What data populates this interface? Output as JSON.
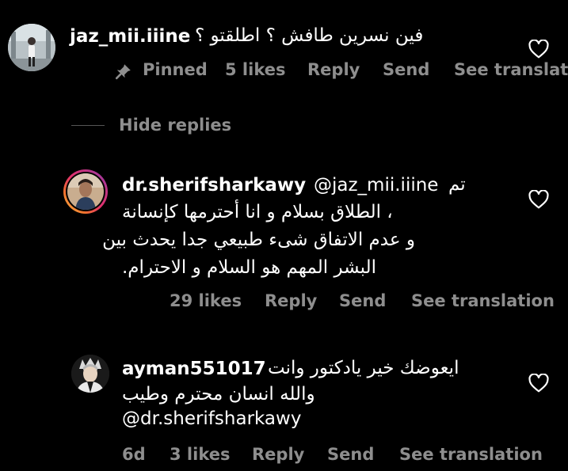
{
  "comment": {
    "username": "jaz_mii.iiine",
    "text": "فين نسرين طافش ؟ اطلقتو ؟",
    "pinned_label": "Pinned",
    "likes": "5 likes",
    "reply": "Reply",
    "send": "Send",
    "see_translation": "See translation"
  },
  "hide_replies": "Hide replies",
  "reply1": {
    "username": "dr.sherifsharkawy",
    "mention": "@jaz_mii.iiine",
    "line1_tail": "تم",
    "line2": "، الطلاق بسلام و انا أحترمها كإنسانة",
    "line3": "و عدم الاتفاق شىء طبيعي جدا يحدث بين",
    "line4": "البشر المهم هو السلام و الاحترام.",
    "likes": "29 likes",
    "reply": "Reply",
    "send": "Send",
    "see_translation": "See translation"
  },
  "reply2": {
    "username": "ayman551017",
    "line1_tail": "ايعوضك خير يادكتور وانت",
    "line2": "والله انسان محترم وطيب",
    "line3": "@dr.sherifsharkawy",
    "age": "6d",
    "likes": "3 likes",
    "reply": "Reply",
    "send": "Send",
    "see_translation": "See translation"
  },
  "icons": {
    "like": "heart-outline-icon",
    "pin": "pin-icon"
  },
  "colors": {
    "background": "#000000",
    "text": "#ffffff",
    "secondary": "#8e8e8e",
    "ring_gradient": [
      "#f9c74f",
      "#e1306c",
      "#833ab4"
    ]
  }
}
